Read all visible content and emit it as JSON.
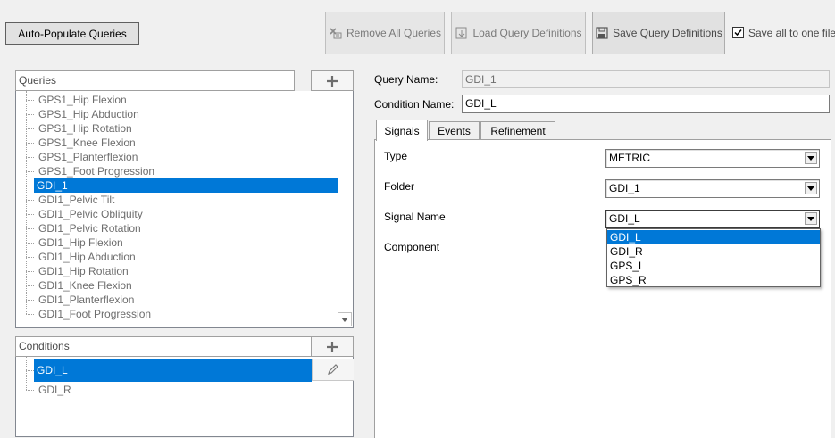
{
  "toolbar": {
    "auto_populate": "Auto-Populate Queries",
    "remove_all": "Remove All Queries",
    "load_defs": "Load Query Definitions",
    "save_defs": "Save Query Definitions",
    "save_all_one_file": "Save all to one file",
    "save_all_checked": true
  },
  "queries": {
    "header": "Queries",
    "add_icon": "plus-icon",
    "items": [
      "GPS1_Hip Flexion",
      "GPS1_Hip Abduction",
      "GPS1_Hip Rotation",
      "GPS1_Knee Flexion",
      "GPS1_Planterflexion",
      "GPS1_Foot Progression",
      "GDI_1",
      "GDI1_Pelvic Tilt",
      "GDI1_Pelvic Obliquity",
      "GDI1_Pelvic Rotation",
      "GDI1_Hip Flexion",
      "GDI1_Hip Abduction",
      "GDI1_Hip Rotation",
      "GDI1_Knee Flexion",
      "GDI1_Planterflexion",
      "GDI1_Foot Progression"
    ],
    "selected_index": 6
  },
  "conditions": {
    "header": "Conditions",
    "items": [
      "GDI_L",
      "GDI_R"
    ],
    "selected_index": 0
  },
  "form": {
    "query_name_label": "Query Name:",
    "query_name_value": "GDI_1",
    "condition_name_label": "Condition Name:",
    "condition_name_value": "GDI_L"
  },
  "tabs": [
    {
      "label": "Signals",
      "active": true
    },
    {
      "label": "Events",
      "active": false
    },
    {
      "label": "Refinement",
      "active": false
    }
  ],
  "signals": {
    "type_label": "Type",
    "type_value": "METRIC",
    "folder_label": "Folder",
    "folder_value": "GDI_1",
    "signal_name_label": "Signal Name",
    "signal_name_value": "GDI_L",
    "component_label": "Component",
    "signal_options": [
      "GDI_L",
      "GDI_R",
      "GPS_L",
      "GPS_R"
    ],
    "signal_selected_index": 0
  },
  "colors": {
    "selection": "#0078d7",
    "background": "#f0f0f0"
  }
}
